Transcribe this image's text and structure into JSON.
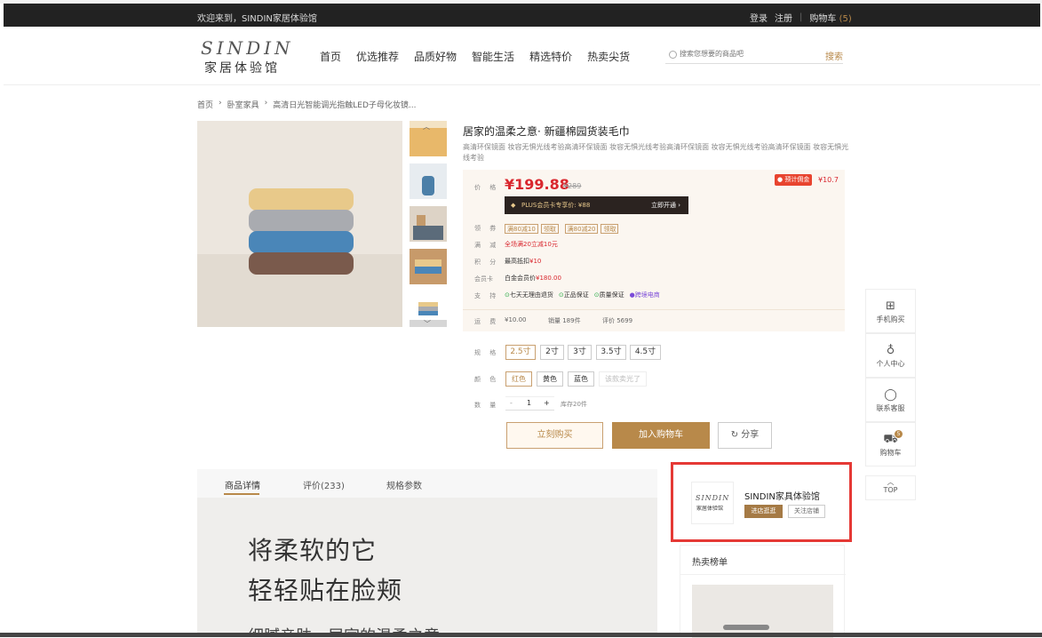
{
  "topbar": {
    "welcome": "欢迎来到，SINDIN家居体验馆",
    "login": "登录",
    "register": "注册",
    "cart": "购物车",
    "cart_count": "(5)"
  },
  "brand": {
    "logo_en": "SINDIN",
    "logo_cn": "家居体验馆"
  },
  "nav": [
    "首页",
    "优选推荐",
    "品质好物",
    "智能生活",
    "精选特价",
    "热卖尖货"
  ],
  "search": {
    "placeholder": "搜索您想要的商品吧",
    "button": "搜索"
  },
  "breadcrumb": [
    "首页",
    "卧室家具",
    "高清日光智能调光指触LED子母化妆镜..."
  ],
  "product": {
    "title": "居家的温柔之意· 新疆棉园货装毛巾",
    "subtitle": "高清环保镜面 妆容无惧光线考验高清环保镜面 妆容无惧光线考验高清环保镜面 妆容无惧光线考验高清环保镜面 妆容无惧光线考验",
    "price_label": "价 格",
    "price": "¥199.88",
    "original_price": "¥289",
    "commission_label": "预计佣金",
    "commission": "¥10.7",
    "plus_text": "PLUS会员卡专享价: ¥88",
    "plus_action": "立即开通 ›",
    "coupon_label": "领 券",
    "coupons": [
      "满80减10",
      "领取",
      "满80减20",
      "领取"
    ],
    "discount_label": "满 减",
    "discount": "全场满20立减10元",
    "points_label": "积 分",
    "points_prefix": "最高抵扣",
    "points": "¥10",
    "member_label": "会员卡",
    "member_prefix": "白金会员价",
    "member": "¥180.00",
    "support_label": "支 持",
    "support": [
      "七天无理由退货",
      "正品保证",
      "质量保证",
      "跨境电商"
    ],
    "shipping_label": "运 费",
    "shipping": "¥10.00",
    "sales": "销量 189件",
    "reviews": "评价 5699",
    "spec_label": "规 格",
    "specs": [
      "2.5寸",
      "2寸",
      "3寸",
      "3.5寸",
      "4.5寸"
    ],
    "color_label": "颜 色",
    "colors": [
      "红色",
      "黄色",
      "蓝色",
      "该款卖光了"
    ],
    "qty_label": "数 量",
    "qty_minus": "-",
    "qty": "1",
    "qty_plus": "+",
    "stock": "库存20件",
    "buy_now": "立刻购买",
    "add_cart": "加入购物车",
    "share": "分享"
  },
  "sidebar": [
    {
      "label": "手机购买",
      "icon": "grid-icon"
    },
    {
      "label": "个人中心",
      "icon": "user-icon"
    },
    {
      "label": "联系客服",
      "icon": "chat-icon"
    },
    {
      "label": "购物车",
      "icon": "cart-icon",
      "badge": "5"
    },
    {
      "label": "TOP",
      "icon": "chevron-up-icon"
    }
  ],
  "tabs": [
    "商品详情",
    "评价(233)",
    "规格参数"
  ],
  "banner": {
    "line1": "将柔软的它",
    "line2": "轻轻贴在脸颊",
    "line3": "细腻亲肤，居家的温柔之意"
  },
  "shop": {
    "logo_en": "SINDIN",
    "logo_cn": "家居体验馆",
    "name": "SINDIN家具体验馆",
    "enter": "进店逛逛",
    "follow": "关注店铺"
  },
  "hot": {
    "title": "热卖榜单"
  },
  "colors_ui": {
    "accent": "#b8894a",
    "price": "#d9272e",
    "highlight": "#e53935",
    "dark": "#222222"
  }
}
